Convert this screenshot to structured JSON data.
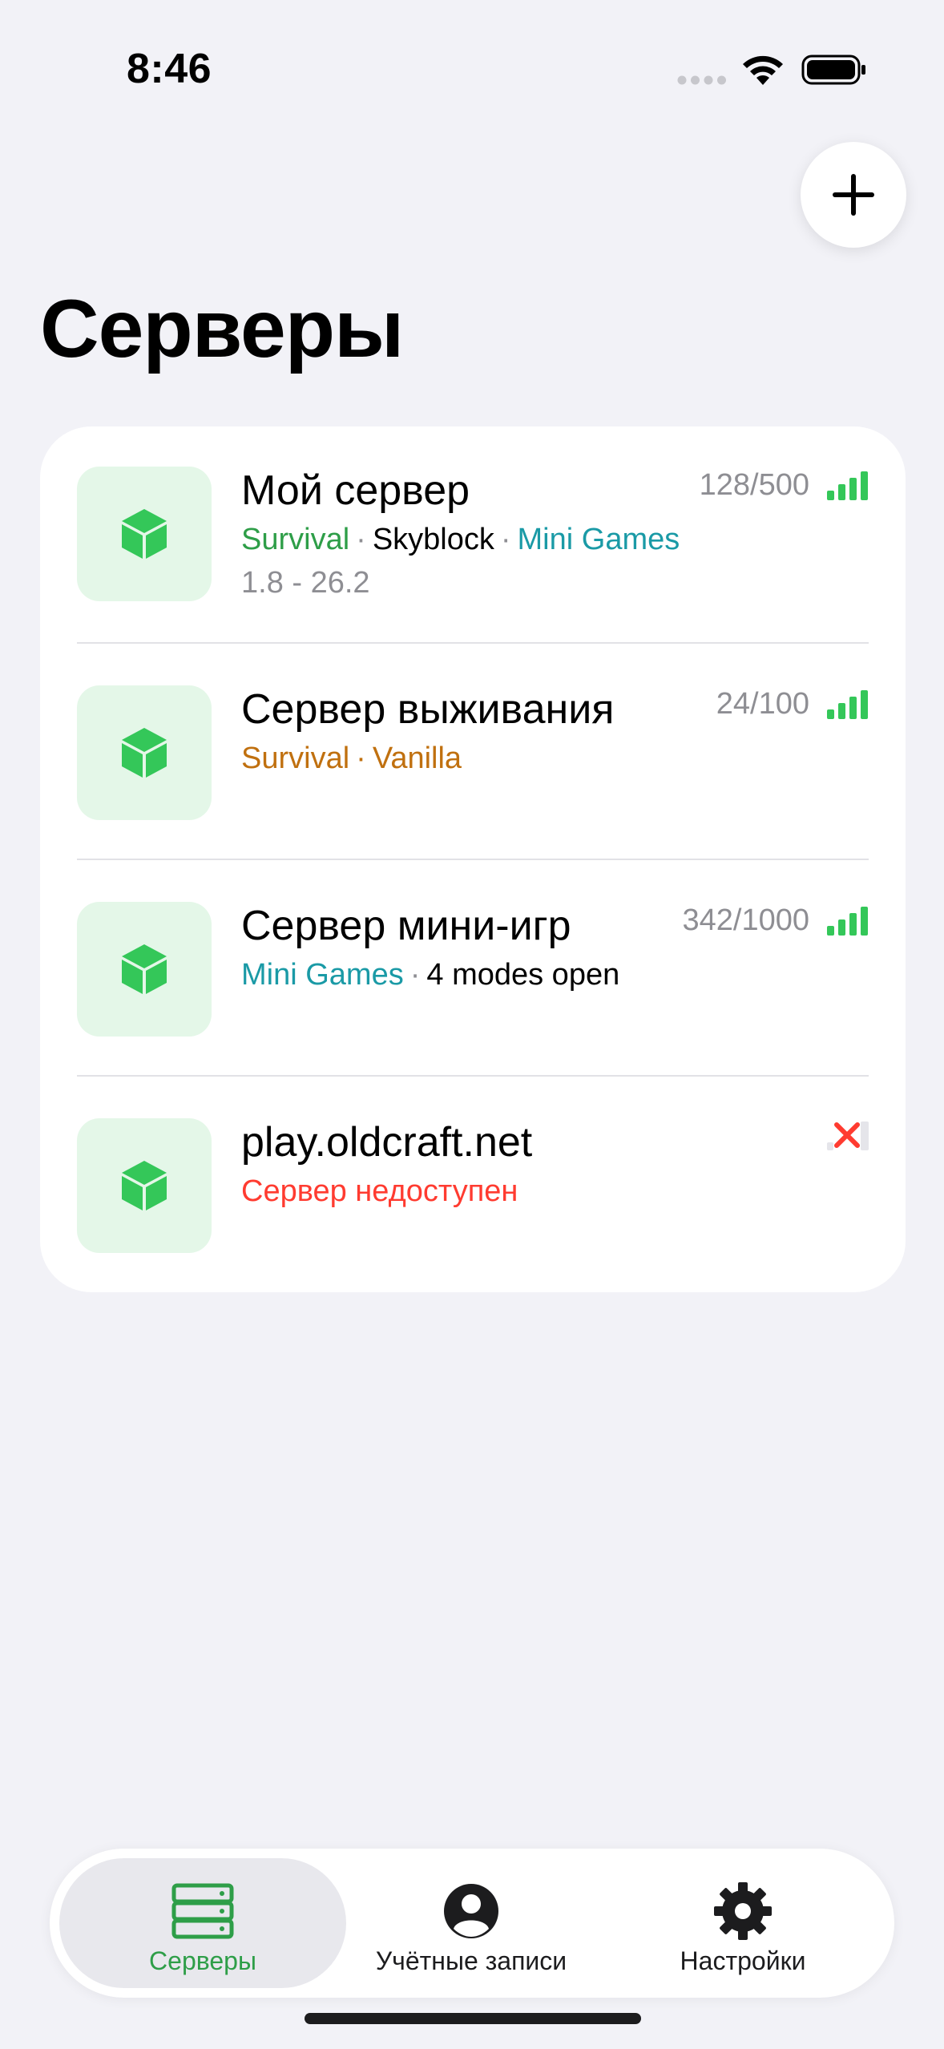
{
  "status_bar": {
    "time": "8:46"
  },
  "header": {
    "title": "Серверы",
    "add_icon": "plus-icon"
  },
  "colors": {
    "accent_green": "#34c759",
    "tag_green": "#2e9e48",
    "tag_teal": "#1a9aa6",
    "tag_orange": "#c0700f",
    "error_red": "#ff3b30",
    "icon_bg": "#e4f7e8"
  },
  "servers": [
    {
      "name": "Мой сервер",
      "players": "128/500",
      "tags": [
        "Survival",
        "Skyblock",
        "Mini Games"
      ],
      "version": "1.8 - 26.2",
      "status": "online",
      "icon": "cube-icon"
    },
    {
      "name": "Сервер выживания",
      "players": "24/100",
      "tags": [
        "Survival",
        "Vanilla"
      ],
      "status": "online",
      "icon": "cube-icon"
    },
    {
      "name": "Сервер мини-игр",
      "players": "342/1000",
      "tags": [
        "Mini Games",
        "4 modes open"
      ],
      "status": "online",
      "icon": "cube-icon"
    },
    {
      "name": "play.oldcraft.net",
      "status_text": "Сервер недоступен",
      "status": "offline",
      "icon": "cube-icon"
    }
  ],
  "tab_bar": {
    "tabs": [
      {
        "label": "Серверы",
        "icon": "server-rack-icon",
        "active": true
      },
      {
        "label": "Учётные записи",
        "icon": "account-icon",
        "active": false
      },
      {
        "label": "Настройки",
        "icon": "gear-icon",
        "active": false
      }
    ]
  }
}
